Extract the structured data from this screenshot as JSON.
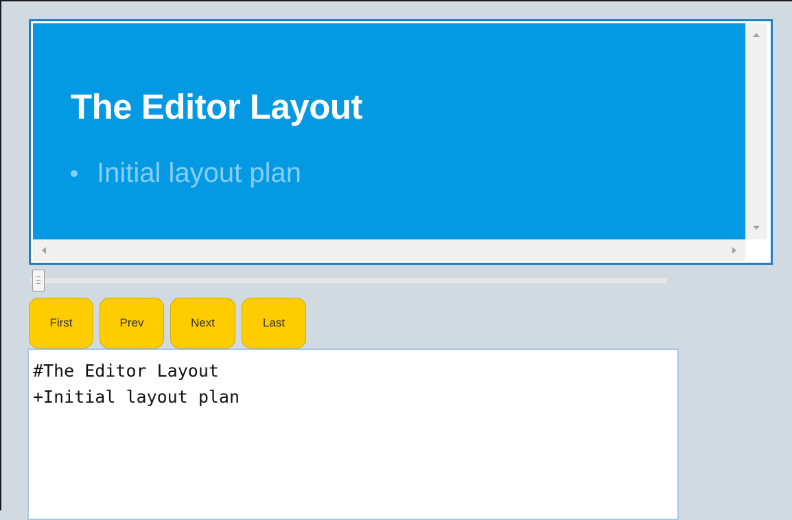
{
  "slide": {
    "title": "The Editor Layout",
    "bullets": [
      "Initial layout plan"
    ]
  },
  "preview_scrollbars": {
    "vertical_up_icon": "arrow-up-icon",
    "vertical_down_icon": "arrow-down-icon",
    "horizontal_left_icon": "arrow-left-icon",
    "horizontal_right_icon": "arrow-right-icon"
  },
  "slider": {
    "value": 0
  },
  "nav": {
    "first_label": "First",
    "prev_label": "Prev",
    "next_label": "Next",
    "last_label": "Last"
  },
  "editor": {
    "lines": [
      "#The Editor Layout",
      "+Initial layout plan"
    ]
  },
  "colors": {
    "page_background": "#d2dae1",
    "slide_background": "#0499e3",
    "slide_title": "#ffffff",
    "slide_bullet": "#86cff4",
    "preview_border": "#1e7fc8",
    "button_fill": "#ffcc00"
  }
}
